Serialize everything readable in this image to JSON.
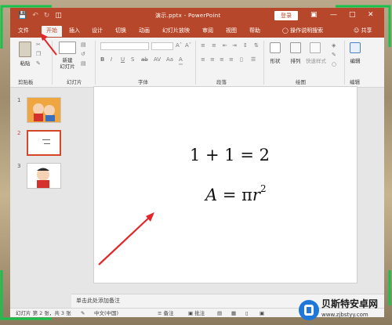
{
  "window": {
    "title": "演示.pptx - PowerPoint",
    "login": "登录",
    "quick_access": [
      "save-icon",
      "undo-icon",
      "redo-icon",
      "start-from-beginning-icon"
    ]
  },
  "tabs": [
    {
      "label": "文件",
      "active": false
    },
    {
      "label": "开始",
      "active": true
    },
    {
      "label": "插入",
      "active": false
    },
    {
      "label": "设计",
      "active": false
    },
    {
      "label": "切换",
      "active": false
    },
    {
      "label": "动画",
      "active": false
    },
    {
      "label": "幻灯片放映",
      "active": false
    },
    {
      "label": "审阅",
      "active": false
    },
    {
      "label": "视图",
      "active": false
    },
    {
      "label": "帮助",
      "active": false
    }
  ],
  "search": "操作说明搜索",
  "share": "共享",
  "ribbon": {
    "groups": [
      "剪贴板",
      "幻灯片",
      "字体",
      "段落",
      "绘图",
      "编辑"
    ],
    "paste": "粘贴",
    "new_slide": "新建\n幻灯片",
    "shapes": "形状",
    "arrange": "排列",
    "quick_styles": "快速样式",
    "editing": "编辑",
    "font_buttons": [
      "B",
      "I",
      "U",
      "S",
      "ab",
      "AV",
      "Aa",
      "A"
    ]
  },
  "thumbnails": [
    {
      "num": "1",
      "selected": false
    },
    {
      "num": "2",
      "selected": true
    },
    {
      "num": "3",
      "selected": false
    }
  ],
  "slide": {
    "eq1": "1 + 1 = 2",
    "eq2_lhs": "A",
    "eq2_eq": " = π",
    "eq2_r": "r",
    "eq2_exp": "2"
  },
  "notes_placeholder": "单击此处添加备注",
  "status": {
    "slide_info": "幻灯片 第 2 张，共 3 张",
    "language": "中文(中国)",
    "notes": "备注",
    "comments": "批注"
  },
  "watermark": {
    "title": "贝斯特安卓网",
    "url": "www.zjbstyy.com"
  },
  "colors": {
    "accent": "#b7472a",
    "annotation_frame": "#17c24b",
    "annotation_arrow": "#e3262a"
  }
}
